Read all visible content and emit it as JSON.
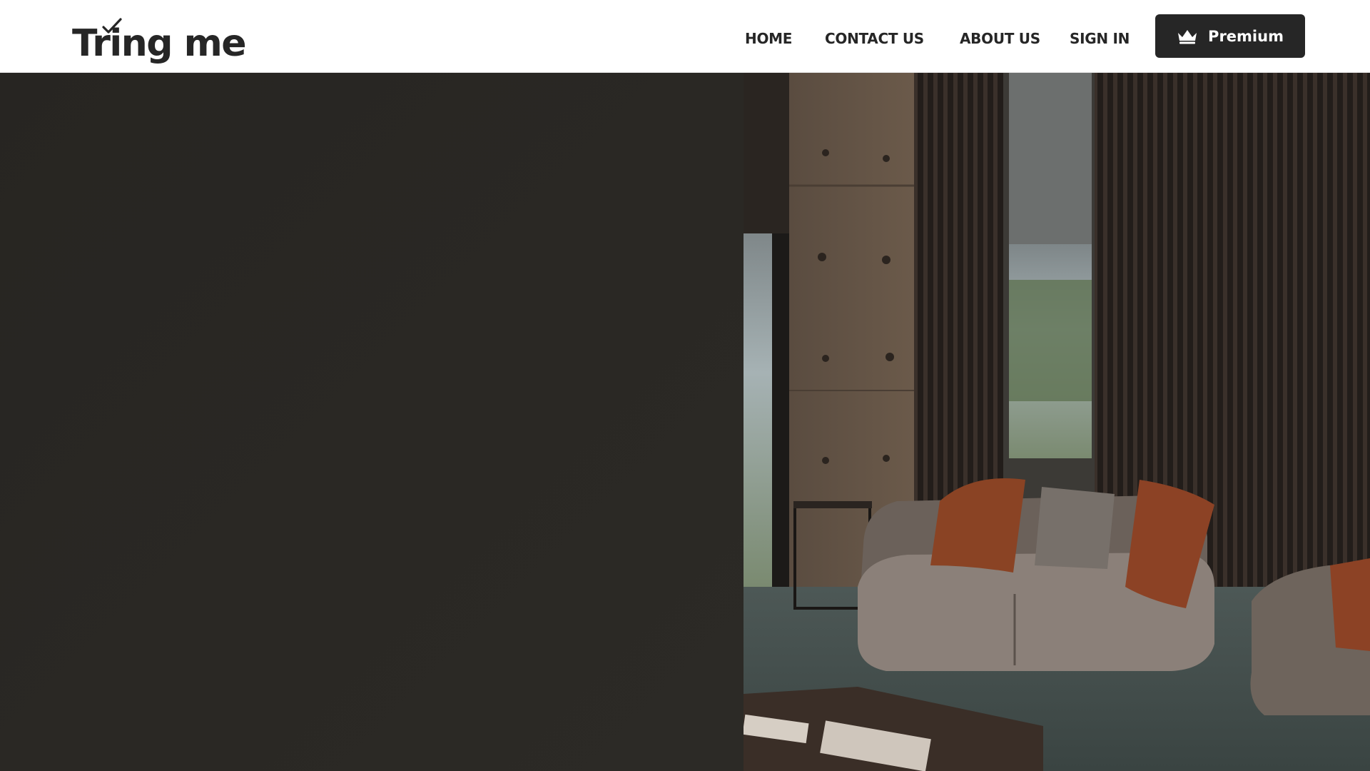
{
  "brand": {
    "name": "Tring me"
  },
  "nav": {
    "items": [
      {
        "label": "HOME"
      },
      {
        "label": "CONTACT US"
      },
      {
        "label": "ABOUT US"
      },
      {
        "label": "SIGN IN"
      }
    ]
  },
  "premium": {
    "label": "Premium",
    "icon": "crown-icon"
  },
  "hero": {
    "image": "lounge-interior-photo",
    "left_panel_color": "#292723"
  },
  "colors": {
    "text_dark": "#262626",
    "button_bg": "#262626",
    "header_bg": "#ffffff"
  }
}
